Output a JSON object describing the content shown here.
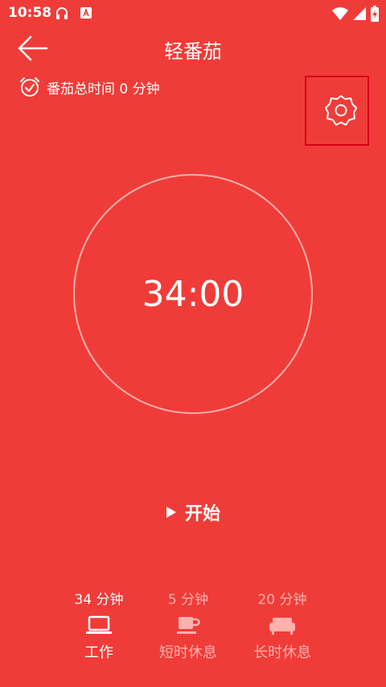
{
  "status_bar": {
    "time": "10:58"
  },
  "header": {
    "title": "轻番茄"
  },
  "summary": {
    "total_time_label": "番茄总时间 0 分钟"
  },
  "timer": {
    "display": "34:00"
  },
  "controls": {
    "start_label": "开始"
  },
  "modes": [
    {
      "duration": "34 分钟",
      "label": "工作",
      "icon": "laptop-icon",
      "active": true
    },
    {
      "duration": "5 分钟",
      "label": "短时休息",
      "icon": "coffee-icon",
      "active": false
    },
    {
      "duration": "20 分钟",
      "label": "长时休息",
      "icon": "sofa-icon",
      "active": false
    }
  ],
  "colors": {
    "background": "#f03c38",
    "inactive_text": "#ffb1ae",
    "highlight_border": "#d9001b"
  }
}
